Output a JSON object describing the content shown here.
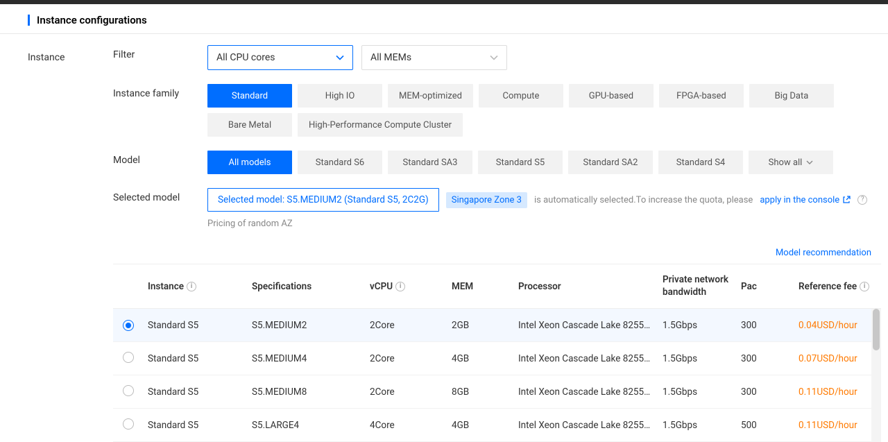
{
  "section_title": "Instance configurations",
  "side_label": "Instance",
  "filter_row": {
    "label": "Filter",
    "cpu_select": "All CPU cores",
    "mem_select": "All MEMs"
  },
  "family_row": {
    "label": "Instance family",
    "options": [
      "Standard",
      "High IO",
      "MEM-optimized",
      "Compute",
      "GPU-based",
      "FPGA-based",
      "Big Data",
      "Bare Metal",
      "High-Performance Compute Cluster"
    ],
    "active": 0
  },
  "model_row": {
    "label": "Model",
    "options": [
      "All models",
      "Standard S6",
      "Standard SA3",
      "Standard S5",
      "Standard SA2",
      "Standard S4"
    ],
    "active": 0,
    "show_all": "Show all"
  },
  "selected_row": {
    "label": "Selected model",
    "selected_text": "Selected model: S5.MEDIUM2 (Standard S5, 2C2G)",
    "zone_badge": "Singapore Zone 3",
    "auto_text": "is automatically selected.To increase the quota, please",
    "console_link": "apply in the console",
    "pricing_text": "Pricing of random AZ"
  },
  "model_recommendation": "Model recommendation",
  "table": {
    "headers": {
      "instance": "Instance",
      "spec": "Specifications",
      "vcpu": "vCPU",
      "mem": "MEM",
      "processor": "Processor",
      "bandwidth": "Private network bandwidth",
      "packet": "Pac",
      "ref_fee": "Reference fee"
    },
    "rows": [
      {
        "selected": true,
        "instance": "Standard S5",
        "spec": "S5.MEDIUM2",
        "vcpu": "2Core",
        "mem": "2GB",
        "processor": "Intel Xeon Cascade Lake 8255C/I...",
        "bandwidth": "1.5Gbps",
        "packet": "300",
        "fee": "0.04USD/hour"
      },
      {
        "selected": false,
        "instance": "Standard S5",
        "spec": "S5.MEDIUM4",
        "vcpu": "2Core",
        "mem": "4GB",
        "processor": "Intel Xeon Cascade Lake 8255C/I...",
        "bandwidth": "1.5Gbps",
        "packet": "300",
        "fee": "0.07USD/hour"
      },
      {
        "selected": false,
        "instance": "Standard S5",
        "spec": "S5.MEDIUM8",
        "vcpu": "2Core",
        "mem": "8GB",
        "processor": "Intel Xeon Cascade Lake 8255C/I...",
        "bandwidth": "1.5Gbps",
        "packet": "300",
        "fee": "0.11USD/hour"
      },
      {
        "selected": false,
        "instance": "Standard S5",
        "spec": "S5.LARGE4",
        "vcpu": "4Core",
        "mem": "4GB",
        "processor": "Intel Xeon Cascade Lake 8255C/I...",
        "bandwidth": "1.5Gbps",
        "packet": "500",
        "fee": "0.11USD/hour"
      }
    ]
  }
}
